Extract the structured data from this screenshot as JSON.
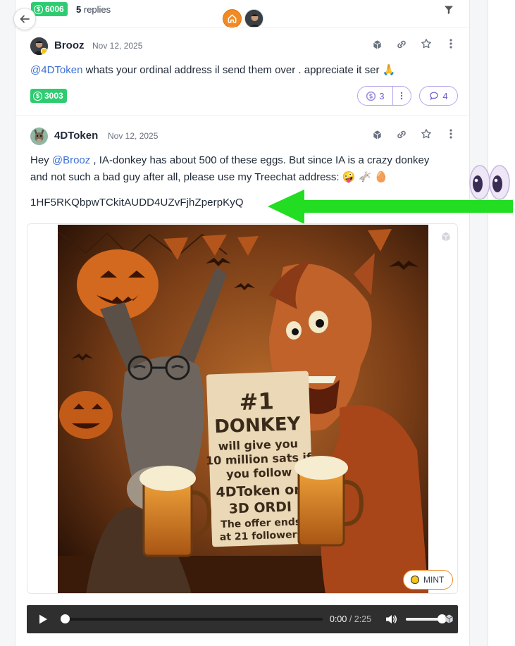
{
  "header": {
    "sats": "6006",
    "replies_count": "5",
    "replies_label": "replies"
  },
  "posts": [
    {
      "username": "Brooz",
      "date": "Nov 12, 2025",
      "mention": "@4DToken",
      "text": " whats your ordinal address il send them over . appreciate it ser 🙏",
      "sats": "3003",
      "reactions_count": "3",
      "comments_count": "4"
    },
    {
      "username": "4DToken",
      "date": "Nov 12, 2025",
      "text_prefix": "Hey ",
      "mention": "@Brooz",
      "text_line1": " , IA-donkey has about 500 of these eggs. But since IA is a crazy donkey",
      "text_line2": "and not such a bad guy after all, please use my Treechat address: 🤪 🫏 🥚",
      "address": "1HF5RKQbpwTCkitAUDD4UZvFjhZperpKyQ"
    }
  ],
  "media": {
    "poster": {
      "heading": "#1",
      "title": "DONKEY",
      "line1": "will give you",
      "line2": "10 million sats if",
      "line3": "you follow",
      "line4": "4DToken on",
      "line5": "3D ORDI",
      "line6": "The offer ends",
      "line7": "at 21 followers"
    },
    "mint_label": "MINT"
  },
  "player": {
    "current_time": "0:00",
    "separator": " / ",
    "duration": "2:25"
  },
  "colors": {
    "sats_green": "#2ecc71",
    "mention_blue": "#3b6fd6",
    "pill_purple": "#6d5bd0",
    "arrow_green": "#22dd22",
    "home_orange": "#f08a24"
  }
}
